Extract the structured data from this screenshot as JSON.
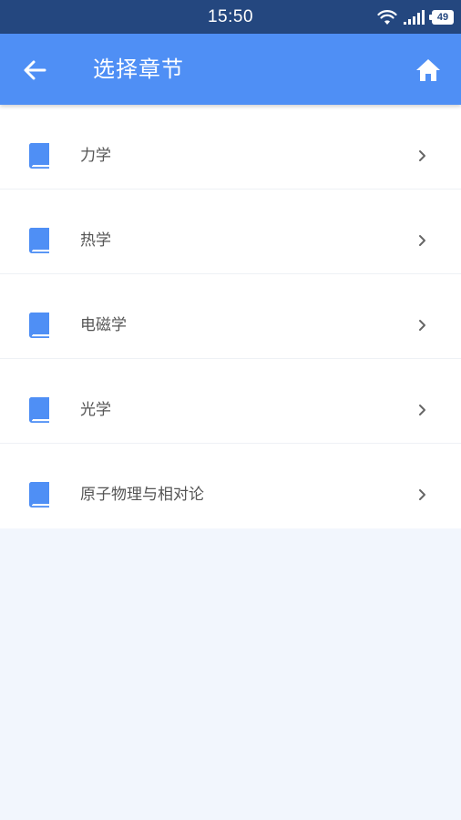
{
  "status_bar": {
    "time": "15:50",
    "battery_level": "49",
    "icons": [
      "wifi-icon",
      "signal-icon",
      "battery-icon"
    ]
  },
  "header": {
    "title": "选择章节",
    "back_icon": "arrow-left-icon",
    "home_icon": "home-icon"
  },
  "chapters": [
    {
      "label": "力学",
      "icon": "book-icon"
    },
    {
      "label": "热学",
      "icon": "book-icon"
    },
    {
      "label": "电磁学",
      "icon": "book-icon"
    },
    {
      "label": "光学",
      "icon": "book-icon"
    },
    {
      "label": "原子物理与相对论",
      "icon": "book-icon"
    }
  ],
  "colors": {
    "status_bar": "#24477f",
    "app_bar": "#4f8ff5",
    "book_icon": "#4f8ff5",
    "background": "#f2f6fd",
    "list_background": "#ffffff",
    "label_text": "#555555",
    "chevron": "#666666"
  }
}
